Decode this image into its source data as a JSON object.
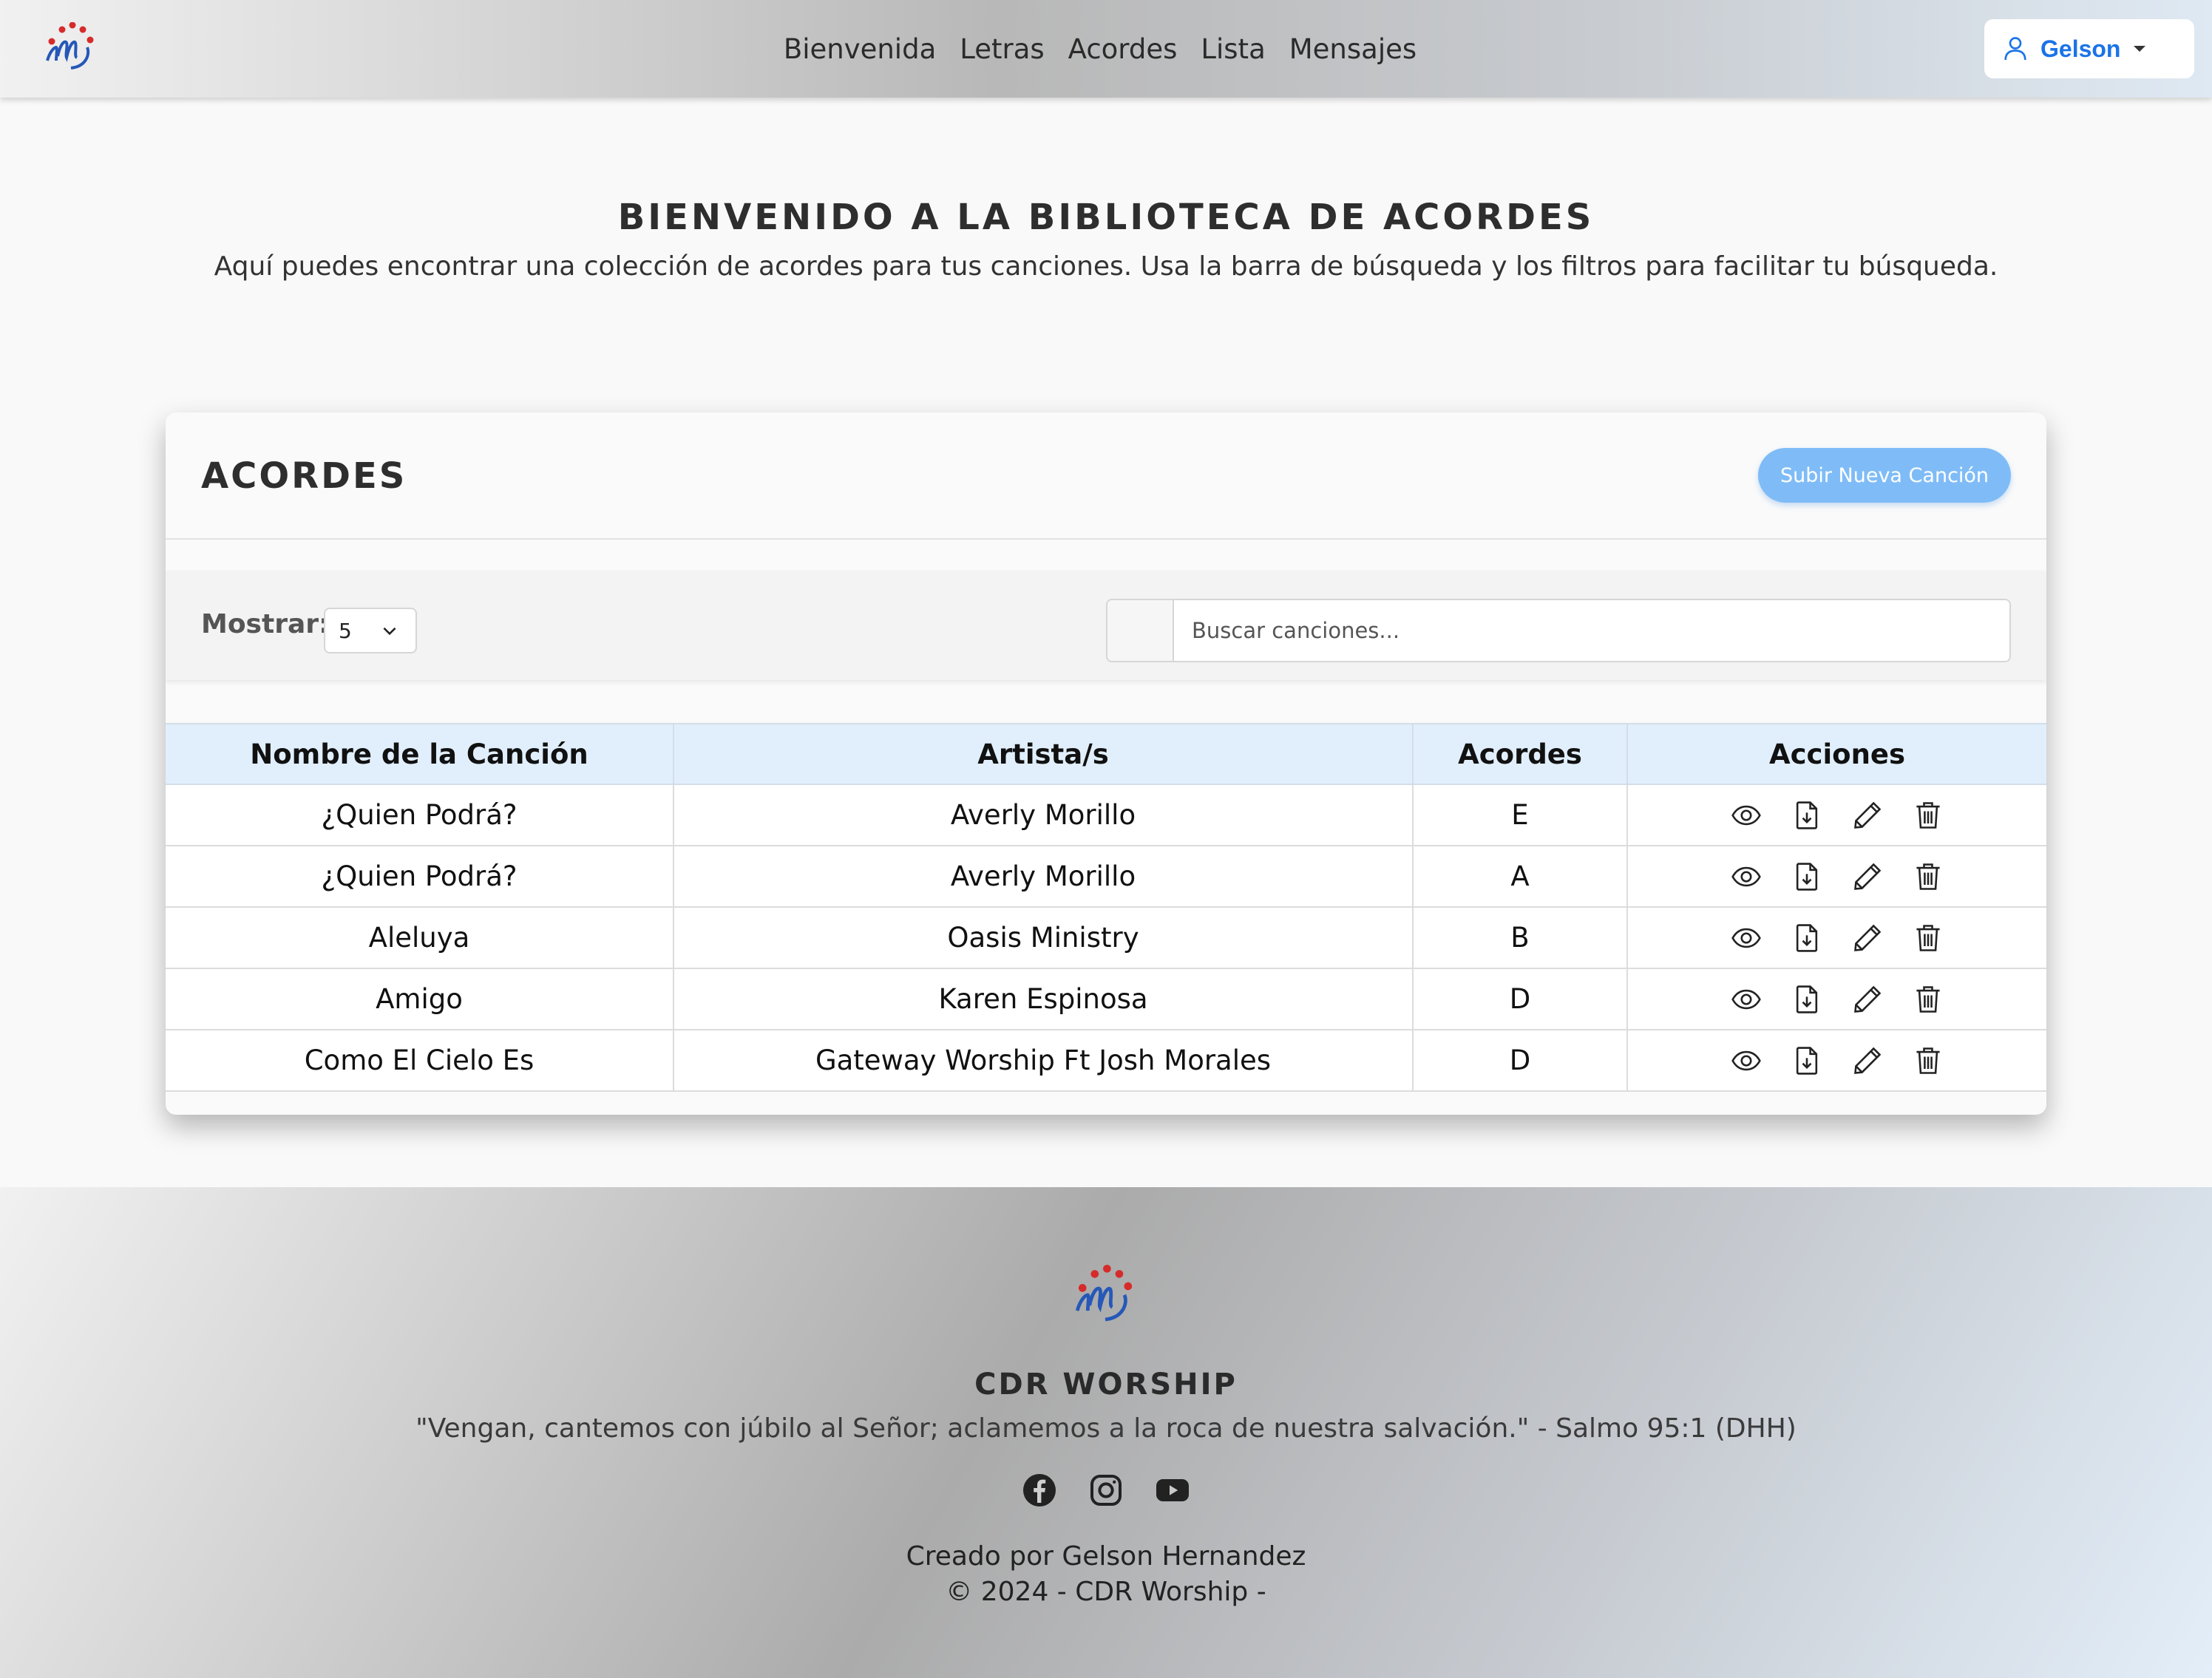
{
  "navbar": {
    "logo_icon": "cdr-worship-logo",
    "links": [
      "Bienvenida",
      "Letras",
      "Acordes",
      "Lista",
      "Mensajes"
    ],
    "user": {
      "icon": "user-icon",
      "name": "Gelson"
    },
    "accent_color": "#1a73e8"
  },
  "hero": {
    "title": "BIENVENIDO A LA BIBLIOTECA DE ACORDES",
    "subtitle": "Aquí puedes encontrar una colección de acordes para tus canciones. Usa la barra de búsqueda y los filtros para facilitar tu búsqueda."
  },
  "card": {
    "title": "ACORDES",
    "upload_label": "Subir Nueva Canción",
    "show_label": "Mostrar:",
    "show_value": "5",
    "search_placeholder": "Buscar canciones..."
  },
  "table": {
    "headers": [
      "Nombre de la Canción",
      "Artista/s",
      "Acordes",
      "Acciones"
    ],
    "action_icons": [
      "eye-icon",
      "file-download-icon",
      "pencil-icon",
      "trash-icon"
    ],
    "rows": [
      {
        "song": "¿Quien Podrá?",
        "artist": "Averly Morillo",
        "chord": "E"
      },
      {
        "song": "¿Quien Podrá?",
        "artist": "Averly Morillo",
        "chord": "A"
      },
      {
        "song": "Aleluya",
        "artist": "Oasis Ministry",
        "chord": "B"
      },
      {
        "song": "Amigo",
        "artist": "Karen Espinosa",
        "chord": "D"
      },
      {
        "song": "Como El Cielo Es",
        "artist": "Gateway Worship Ft Josh Morales",
        "chord": "D"
      }
    ]
  },
  "footer": {
    "brand": "CDR WORSHIP",
    "quote": "\"Vengan, cantemos con júbilo al Señor; aclamemos a la roca de nuestra salvación.\" - Salmo 95:1 (DHH)",
    "social_icons": [
      "facebook-icon",
      "instagram-icon",
      "youtube-icon"
    ],
    "credit": "Creado por Gelson Hernandez",
    "copyright": "© 2024 - CDR Worship -"
  }
}
